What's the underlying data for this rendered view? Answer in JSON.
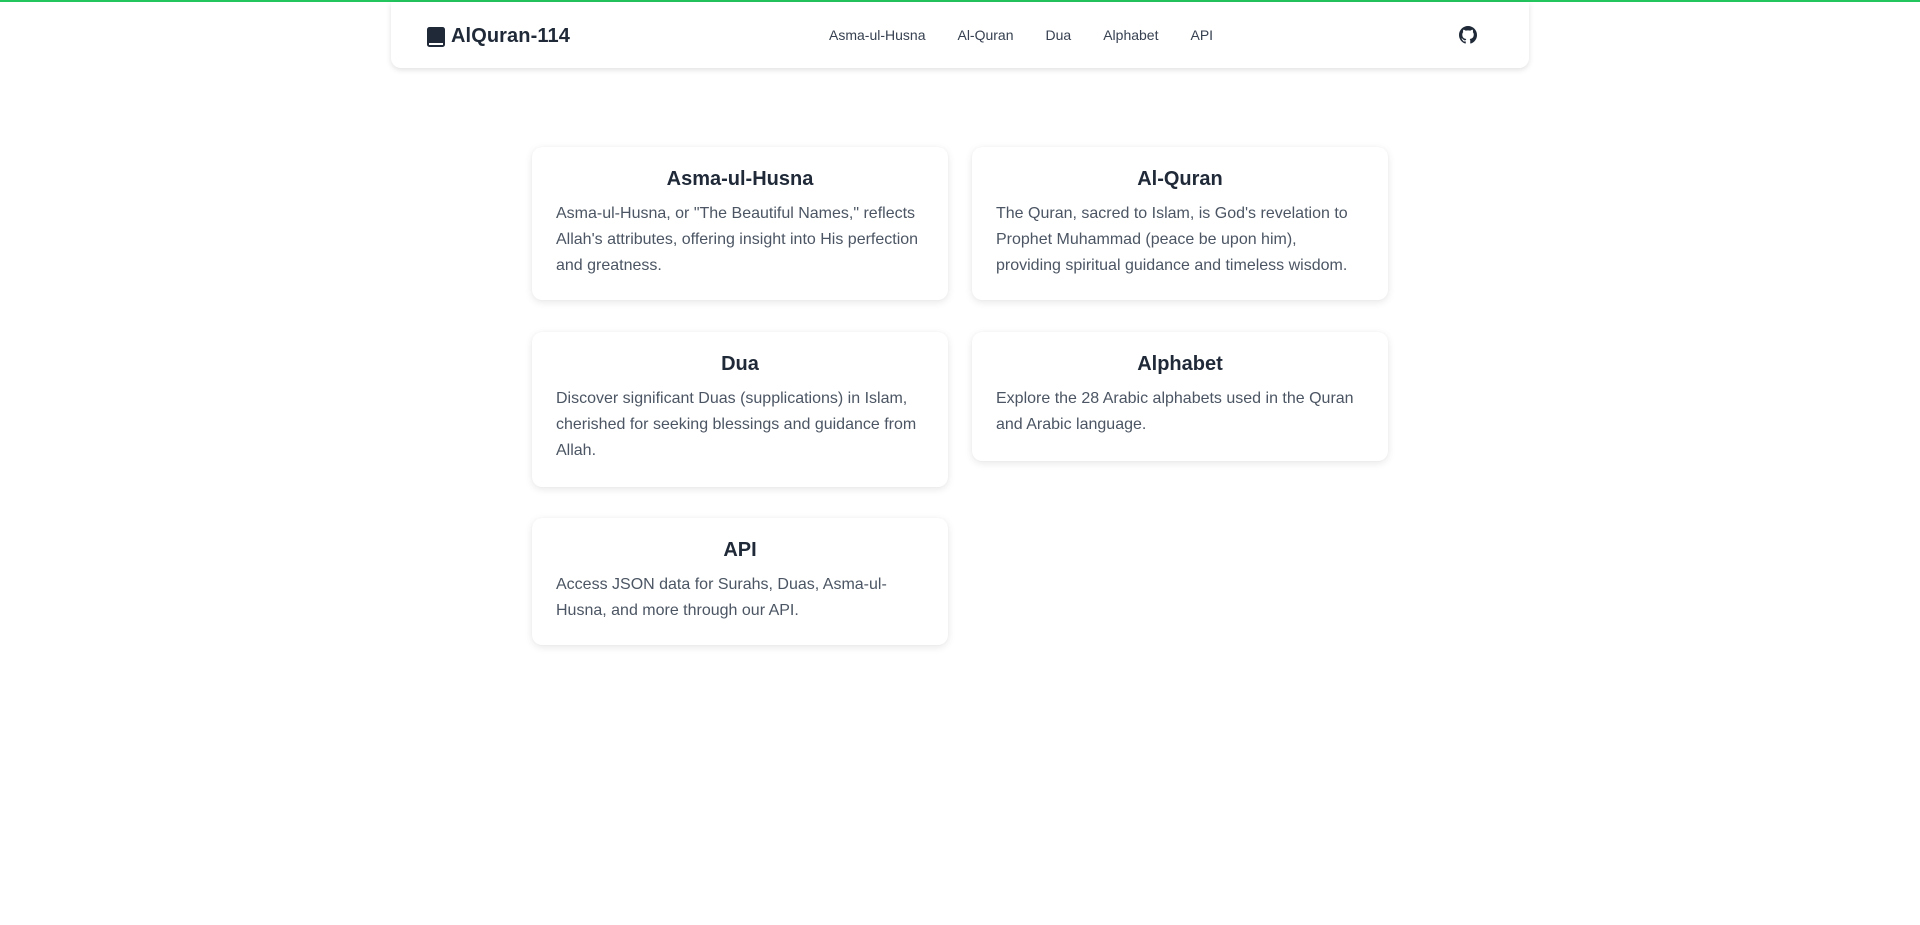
{
  "theme": {
    "accent": "#22c55e"
  },
  "header": {
    "brand": "AlQuran-114",
    "brand_icon": "quran-book-icon",
    "nav": [
      {
        "label": "Asma-ul-Husna"
      },
      {
        "label": "Al-Quran"
      },
      {
        "label": "Dua"
      },
      {
        "label": "Alphabet"
      },
      {
        "label": "API"
      }
    ],
    "github_icon": "github-icon"
  },
  "cards": [
    {
      "title": "Asma-ul-Husna",
      "description": "Asma-ul-Husna, or \"The Beautiful Names,\" reflects Allah's attributes, offering insight into His perfection and greatness."
    },
    {
      "title": "Al-Quran",
      "description": "The Quran, sacred to Islam, is God's revelation to Prophet Muhammad (peace be upon him), providing spiritual guidance and timeless wisdom."
    },
    {
      "title": "Dua",
      "description": "Discover significant Duas (supplications) in Islam, cherished for seeking blessings and guidance from Allah."
    },
    {
      "title": "Alphabet",
      "description": "Explore the 28 Arabic alphabets used in the Quran and Arabic language."
    },
    {
      "title": "API",
      "description": "Access JSON data for Surahs, Duas, Asma-ul-Husna, and more through our API."
    }
  ]
}
